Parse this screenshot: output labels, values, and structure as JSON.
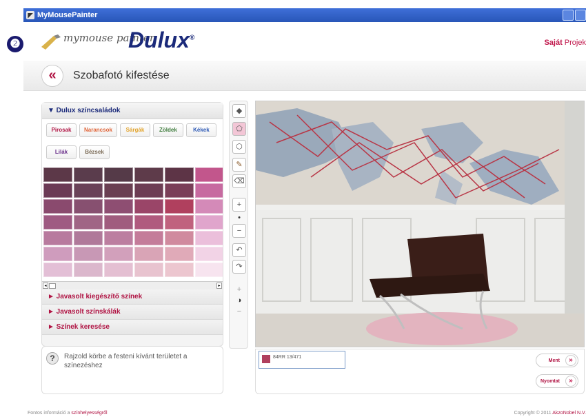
{
  "window": {
    "title": "MyMousePainter"
  },
  "step_badge": "❷",
  "header": {
    "logo_small": "mymouse painter",
    "logo_brand": "Dulux",
    "logo_mark": "®",
    "link_bold": "Saját",
    "link_rest": " Projek"
  },
  "banner": {
    "back_label": "«",
    "title": "Szobafotó kifestése"
  },
  "left_panel": {
    "families_heading": "▼ Dulux színcsaládok",
    "families": [
      {
        "label": "Pirosak",
        "color": "#b01343"
      },
      {
        "label": "Narancsok",
        "color": "#e0663a"
      },
      {
        "label": "Sárgák",
        "color": "#e2a32b"
      },
      {
        "label": "Zöldek",
        "color": "#3c7a3a"
      },
      {
        "label": "Kékek",
        "color": "#2c58b5"
      },
      {
        "label": "Lilák",
        "color": "#6a2f8a"
      },
      {
        "label": "Bézsek",
        "color": "#7a6a55"
      }
    ],
    "swatch_colors": [
      "#5c3848",
      "#5a3c4c",
      "#553a48",
      "#5e3b4a",
      "#5d3446",
      "#c2568c",
      "#6b3a55",
      "#6a4258",
      "#6a3f52",
      "#6d3d54",
      "#7a3e58",
      "#c76aa0",
      "#8a4a6e",
      "#875070",
      "#8e4e72",
      "#9a4568",
      "#b0405e",
      "#d48ab8",
      "#9f5a82",
      "#a06585",
      "#a05c7e",
      "#b05a7e",
      "#c0627e",
      "#e0a5cc",
      "#b87a9e",
      "#b0799a",
      "#bc7ea0",
      "#c47c9a",
      "#d08a9e",
      "#ebbfdb",
      "#cf9cbd",
      "#c898b5",
      "#d2a0bb",
      "#d9a4b6",
      "#e0aab8",
      "#f2d3e6",
      "#e3bfd6",
      "#dbb7cc",
      "#e4bfd2",
      "#e8c3cf",
      "#ecc6cf",
      "#f7e4ef"
    ],
    "collapsed_sections": [
      "► Javasolt kiegészítő színek",
      "► Javasolt színskálák",
      "► Színek keresése"
    ],
    "scroll_left": "◂",
    "scroll_right": "▸"
  },
  "help": {
    "icon": "?",
    "text": "Rajzold körbe a festeni kívánt területet a színezéshez"
  },
  "tools": {
    "bucket": "◆",
    "polygon": "⬠",
    "polygon_erase": "⬡",
    "brush": "✎",
    "eraser": "⌫",
    "zoom_in": "+",
    "zoom_dot": "•",
    "zoom_out": "−",
    "undo": "↶",
    "redo": "↷",
    "contrast_plus": "+",
    "contrast_icon": "◑",
    "contrast_minus": "−"
  },
  "current_color": {
    "code": "84RR 13/471",
    "color": "#b0405e"
  },
  "actions": {
    "save": "Ment",
    "print": "Nyomtat",
    "arrow": "»"
  },
  "footer": {
    "left_text": "Fontos információ a ",
    "left_link": "színhelyességről",
    "right_text": "Copyright © 2011 ",
    "right_link": "AkzoNobel N.V."
  }
}
